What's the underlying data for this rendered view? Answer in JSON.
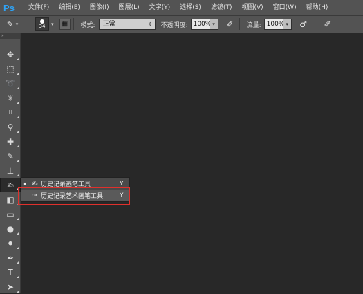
{
  "app": {
    "logo": "Ps"
  },
  "menu": [
    "文件(F)",
    "编辑(E)",
    "图像(I)",
    "图层(L)",
    "文字(Y)",
    "选择(S)",
    "滤镜(T)",
    "视图(V)",
    "窗口(W)",
    "帮助(H)"
  ],
  "options": {
    "brush_size": "34",
    "mode_label": "模式:",
    "mode_value": "正常",
    "opacity_label": "不透明度:",
    "opacity_value": "100%",
    "flow_label": "流量:",
    "flow_value": "100%"
  },
  "flyout": {
    "items": [
      {
        "label": "历史记录画笔工具",
        "shortcut": "Y",
        "icon": "history-brush-icon",
        "active": true
      },
      {
        "label": "历史记录艺术画笔工具",
        "shortcut": "Y",
        "icon": "art-history-brush-icon",
        "active": false
      }
    ]
  },
  "colors": {
    "highlight": "#e0302c",
    "logo": "#2fa3f5",
    "canvas": "#282828",
    "panel": "#535353"
  }
}
